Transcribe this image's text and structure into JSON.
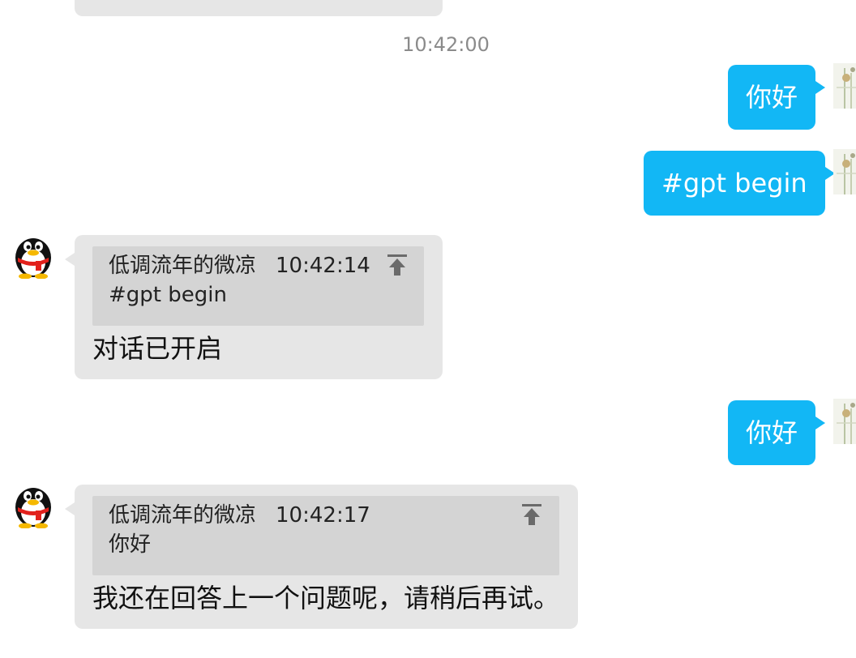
{
  "chat": {
    "timestamp": "10:42:00",
    "messages": [
      {
        "from": "self",
        "text": "你好"
      },
      {
        "from": "self",
        "text": "#gpt begin"
      },
      {
        "from": "bot",
        "quote": {
          "sender": "低调流年的微凉",
          "time": "10:42:14",
          "text": "#gpt begin"
        },
        "text": "对话已开启"
      },
      {
        "from": "self",
        "text": "你好"
      },
      {
        "from": "bot",
        "quote": {
          "sender": "低调流年的微凉",
          "time": "10:42:17",
          "text": "你好"
        },
        "text": "我还在回答上一个问题呢，请稍后再试。"
      }
    ]
  },
  "colors": {
    "outgoing_bubble": "#12b7f5",
    "incoming_bubble": "#e6e6e6",
    "quote_block": "#d4d4d4",
    "timestamp_text": "#8b8b8b"
  },
  "icons": {
    "bot_avatar": "qq-penguin-avatar",
    "self_avatar": "plant-photo-avatar",
    "quote_action": "pin-to-top-icon"
  }
}
